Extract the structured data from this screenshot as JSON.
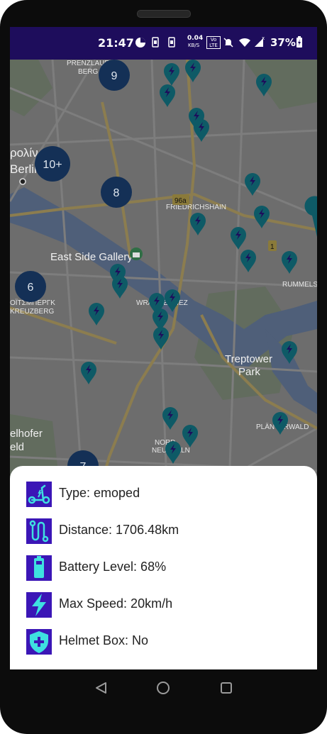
{
  "status_bar": {
    "time": "21:47",
    "net_speed_top": "0.04",
    "net_speed_bottom": "KB/S",
    "volte": "Vo LTE",
    "battery_percent": "37%"
  },
  "map": {
    "labels": {
      "prenzlauer": "PRENZLAUER",
      "berg": "BERG",
      "berlin_greek": "ρολίν",
      "berlin": "Berlin",
      "road_96a": "96a",
      "friedrichshain": "FRIEDRICHSHAIN",
      "road_1": "1",
      "east_side_gallery": "East Side Gallery",
      "rummels": "RUMMELS",
      "kreuzberg_greek": "ΟΪΤΣΜΠΕΡΓΚ",
      "kreuzberg": "KREUZBERG",
      "wrangelkiez": "WRANGELKIEZ",
      "treptower": "Treptower",
      "park": "Park",
      "planterwald": "PLÄNTERWALD",
      "nord": "NORD-",
      "neukolln": "NEUKÖLLN",
      "tempelhofer": "elhofer",
      "feld": "eld"
    },
    "clusters": [
      "9",
      "10+",
      "8",
      "6",
      "7"
    ]
  },
  "sheet": {
    "type": "Type: emoped",
    "distance": "Distance: 1706.48km",
    "battery": "Battery Level: 68%",
    "speed": "Max Speed: 20km/h",
    "helmet": "Helmet Box: No"
  },
  "colors": {
    "accent_purple": "#3b16b6",
    "icon_cyan": "#3ee0e0",
    "marker_teal": "#0e5a66",
    "cluster_navy": "#143056",
    "status_bar": "#1e0d5c"
  },
  "icons": [
    "scooter-icon",
    "route-icon",
    "battery-icon",
    "lightning-icon",
    "shield-plus-icon"
  ]
}
